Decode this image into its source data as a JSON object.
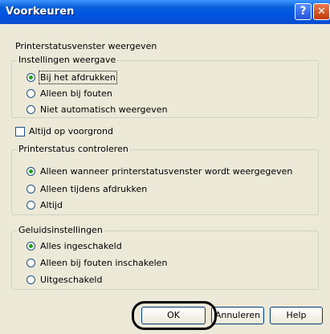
{
  "window": {
    "title": "Voorkeuren"
  },
  "titlebar": {
    "help_glyph": "?",
    "close_glyph": "✕"
  },
  "section_title": "Printerstatusvenster weergeven",
  "display_settings": {
    "legend": "Instellingen weergave",
    "options": [
      {
        "label": "Bij het afdrukken",
        "selected": true
      },
      {
        "label": "Alleen bij fouten",
        "selected": false
      },
      {
        "label": "Niet automatisch weergeven",
        "selected": false
      }
    ]
  },
  "always_on_top": {
    "label": "Altijd op voorgrond",
    "checked": false
  },
  "printer_status_check": {
    "legend": "Printerstatus controleren",
    "options": [
      {
        "label": "Alleen wanneer printerstatusvenster wordt weergegeven",
        "selected": true
      },
      {
        "label": "Alleen tijdens afdrukken",
        "selected": false
      },
      {
        "label": "Altijd",
        "selected": false
      }
    ]
  },
  "sound_settings": {
    "legend": "Geluidsinstellingen",
    "options": [
      {
        "label": "Alles ingeschakeld",
        "selected": true
      },
      {
        "label": "Alleen bij fouten inschakelen",
        "selected": false
      },
      {
        "label": "Uitgeschakeld",
        "selected": false
      }
    ]
  },
  "buttons": {
    "ok": "OK",
    "cancel": "Annuleren",
    "help": "Help"
  },
  "colors": {
    "titlebar": "#0054e3",
    "dialog_bg": "#ece9d8",
    "radio_dot": "#21a121"
  }
}
